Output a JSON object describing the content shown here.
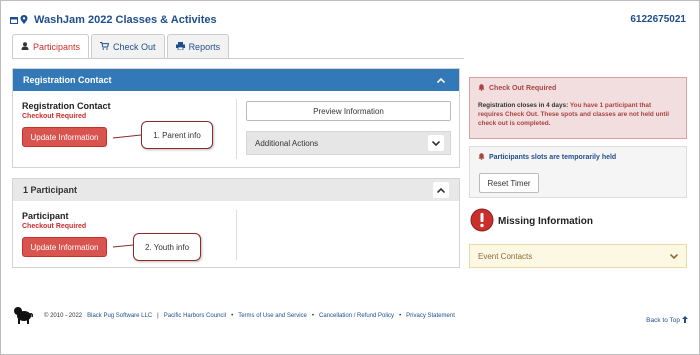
{
  "header": {
    "title": "WashJam 2022 Classes & Activites",
    "phone": "6122675021"
  },
  "tabs": [
    {
      "label": "Participants",
      "icon": "user-icon"
    },
    {
      "label": "Check Out",
      "icon": "cart-icon"
    },
    {
      "label": "Reports",
      "icon": "print-icon"
    }
  ],
  "registration_panel": {
    "header": "Registration Contact",
    "label": "Registration Contact",
    "status": "Checkout Required",
    "update_button": "Update Information",
    "preview_button": "Preview Information",
    "additional_actions": "Additional Actions"
  },
  "participant_panel": {
    "header": "1 Participant",
    "label": "Participant",
    "status": "Checkout Required",
    "update_button": "Update Information"
  },
  "callouts": {
    "parent": "1.  Parent info",
    "youth": "2.  Youth info"
  },
  "alerts": {
    "checkout_title": "Check Out Required",
    "checkout_prefix": "Registration closes in 4 days:",
    "checkout_body": "You have 1 participant that requires Check Out. These spots and classes are not held until check out is completed.",
    "slots_title": "Participants slots are temporarily held",
    "reset_button": "Reset Timer",
    "missing_info": "Missing Information",
    "event_contacts": "Event Contacts"
  },
  "footer": {
    "copyright": "© 2010 - 2022",
    "company": "Black Pug Software LLC",
    "council": "Pacific Harbors Council",
    "terms": "Terms of Use and Service",
    "cancellation": "Cancellation / Refund Policy",
    "privacy": "Privacy Statement",
    "back_to_top": "Back to Top"
  },
  "colors": {
    "primary": "#3379b7",
    "danger": "#d9534f",
    "link": "#1f4e8c"
  }
}
